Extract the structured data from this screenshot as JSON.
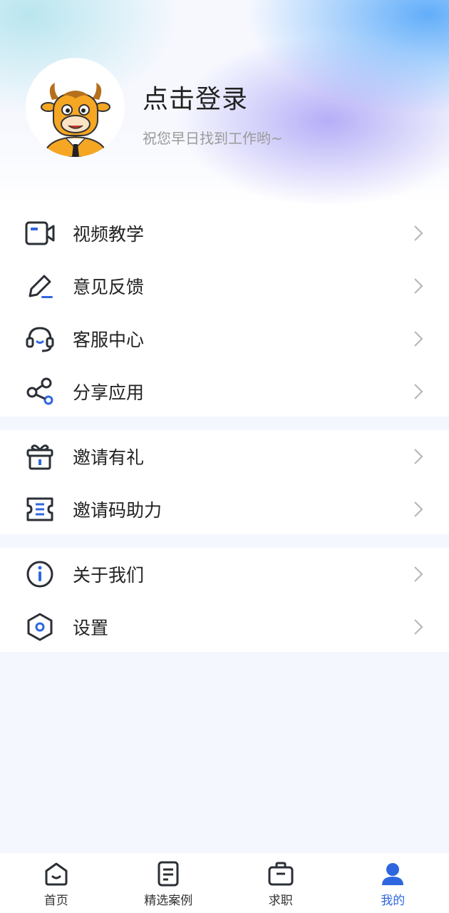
{
  "profile": {
    "title": "点击登录",
    "subtitle": "祝您早日找到工作哟~",
    "avatar_icon": "cartoon-bull-avatar"
  },
  "menu_groups": [
    [
      {
        "label": "视频教学",
        "icon": "video-icon"
      },
      {
        "label": "意见反馈",
        "icon": "edit-pen-icon"
      },
      {
        "label": "客服中心",
        "icon": "headset-icon"
      },
      {
        "label": "分享应用",
        "icon": "share-icon"
      }
    ],
    [
      {
        "label": "邀请有礼",
        "icon": "gift-icon"
      },
      {
        "label": "邀请码助力",
        "icon": "ticket-icon"
      }
    ],
    [
      {
        "label": "关于我们",
        "icon": "info-icon"
      },
      {
        "label": "设置",
        "icon": "settings-hexagon-icon"
      }
    ]
  ],
  "tabbar": {
    "items": [
      {
        "label": "首页",
        "icon": "home-icon"
      },
      {
        "label": "精选案例",
        "icon": "document-icon"
      },
      {
        "label": "求职",
        "icon": "briefcase-icon"
      },
      {
        "label": "我的",
        "icon": "user-icon",
        "active": true
      }
    ]
  },
  "colors": {
    "accent": "#2f66e0",
    "icon_stroke": "#2b2f36",
    "background": "#f4f7fd",
    "avatar_orange": "#f5a623"
  }
}
